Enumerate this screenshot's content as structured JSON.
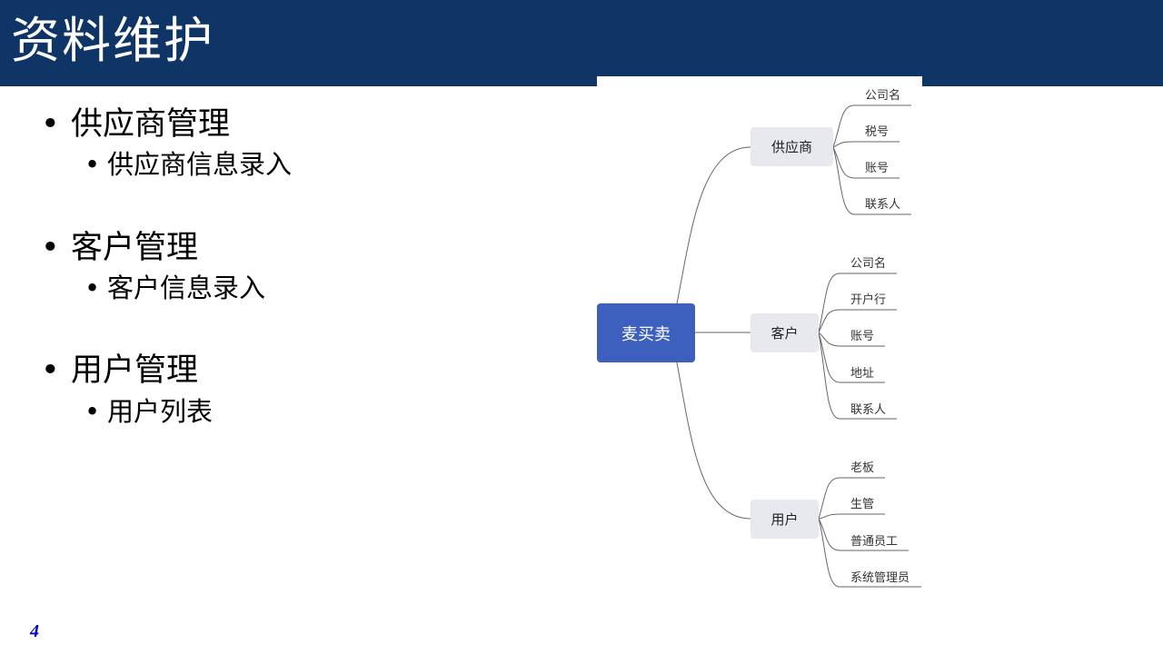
{
  "slide": {
    "title": "资料维护",
    "page_number": "4"
  },
  "bullets": [
    {
      "label": "供应商管理",
      "sub": "供应商信息录入"
    },
    {
      "label": "客户管理",
      "sub": "客户信息录入"
    },
    {
      "label": "用户管理",
      "sub": "用户列表"
    }
  ],
  "mindmap": {
    "root": "麦买卖",
    "branches": [
      {
        "label": "供应商",
        "leaves": [
          "公司名",
          "税号",
          "账号",
          "联系人"
        ]
      },
      {
        "label": "客户",
        "leaves": [
          "公司名",
          "开户行",
          "账号",
          "地址",
          "联系人"
        ]
      },
      {
        "label": "用户",
        "leaves": [
          "老板",
          "生管",
          "普通员工",
          "系统管理员"
        ]
      }
    ]
  },
  "colors": {
    "header": "#0f3567",
    "root_node": "#3d5fbd",
    "branch_node": "#e8e9ee",
    "page_number": "#0000cc"
  }
}
